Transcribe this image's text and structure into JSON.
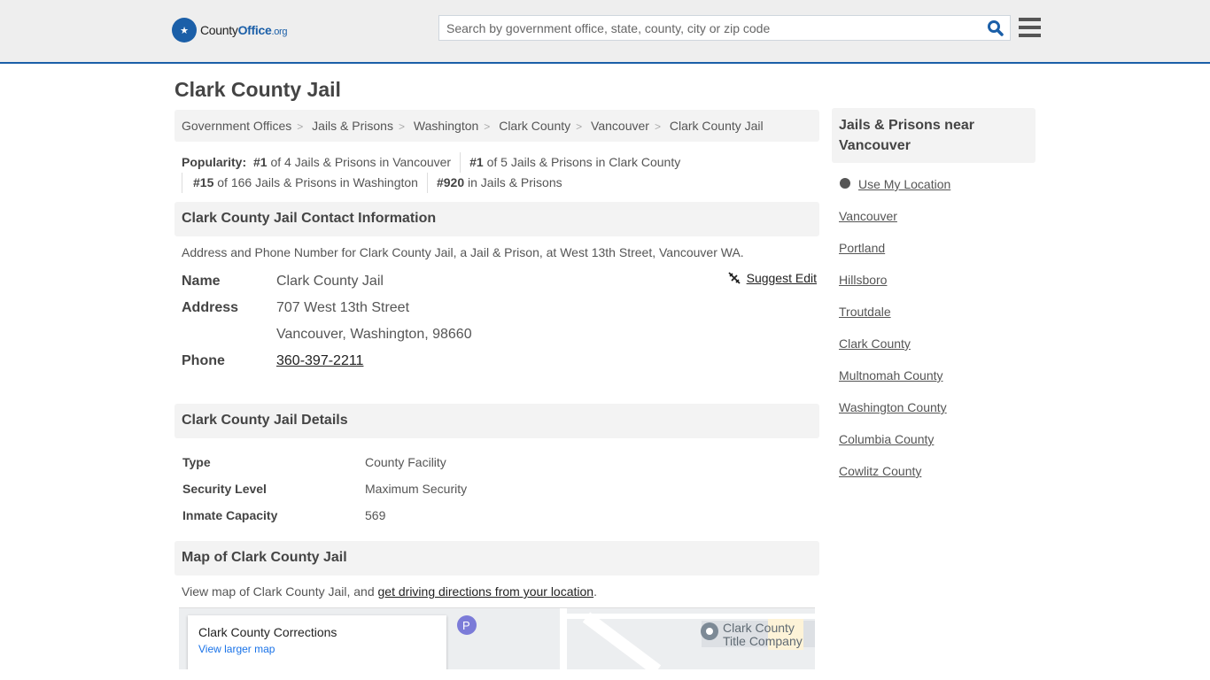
{
  "header": {
    "logo_text": "County",
    "logo_text_bold": "Office",
    "logo_text_suffix": ".org",
    "search_placeholder": "Search by government office, state, county, city or zip code"
  },
  "page_title": "Clark County Jail",
  "breadcrumb": [
    "Government Offices",
    "Jails & Prisons",
    "Washington",
    "Clark County",
    "Vancouver",
    "Clark County Jail"
  ],
  "popularity": {
    "label": "Popularity:",
    "items": [
      {
        "rank": "#1",
        "text": " of 4 Jails & Prisons in Vancouver"
      },
      {
        "rank": "#1",
        "text": " of 5 Jails & Prisons in Clark County"
      },
      {
        "rank": "#15",
        "text": " of 166 Jails & Prisons in Washington"
      },
      {
        "rank": "#920",
        "text": " in Jails & Prisons"
      }
    ]
  },
  "contact": {
    "heading": "Clark County Jail Contact Information",
    "description": "Address and Phone Number for Clark County Jail, a Jail & Prison, at West 13th Street, Vancouver WA.",
    "suggest_edit": "Suggest Edit",
    "name_label": "Name",
    "name_value": "Clark County Jail",
    "address_label": "Address",
    "address_line1": "707 West 13th Street",
    "address_line2": "Vancouver, Washington, 98660",
    "phone_label": "Phone",
    "phone_value": "360-397-2211"
  },
  "details": {
    "heading": "Clark County Jail Details",
    "rows": [
      {
        "label": "Type",
        "value": "County Facility"
      },
      {
        "label": "Security Level",
        "value": "Maximum Security"
      },
      {
        "label": "Inmate Capacity",
        "value": "569"
      }
    ]
  },
  "map_section": {
    "heading": "Map of Clark County Jail",
    "text_before": "View map of Clark County Jail, and ",
    "link": "get driving directions from your location",
    "text_after": ".",
    "card_title": "Clark County Corrections",
    "card_link": "View larger map",
    "poi_label_1": "Clark County",
    "poi_label_2": "Title Company"
  },
  "sidebar": {
    "heading": "Jails & Prisons near Vancouver",
    "use_location": "Use My Location",
    "links": [
      "Vancouver",
      "Portland",
      "Hillsboro",
      "Troutdale",
      "Clark County",
      "Multnomah County",
      "Washington County",
      "Columbia County",
      "Cowlitz County"
    ]
  }
}
